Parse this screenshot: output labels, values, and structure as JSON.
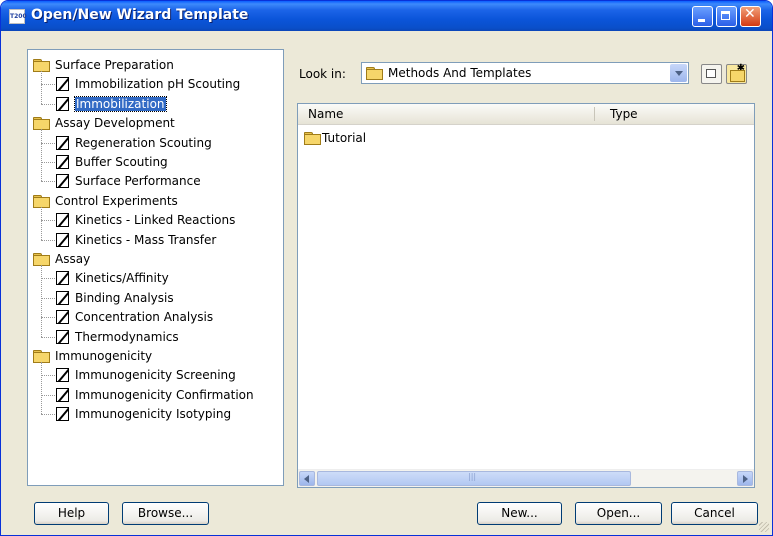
{
  "window": {
    "title": "Open/New Wizard Template",
    "app_icon_text": "T200"
  },
  "tree": {
    "groups": [
      {
        "label": "Surface Preparation",
        "items": [
          "Immobilization pH Scouting",
          "Immobilization"
        ]
      },
      {
        "label": "Assay Development",
        "items": [
          "Regeneration Scouting",
          "Buffer Scouting",
          "Surface Performance"
        ]
      },
      {
        "label": "Control Experiments",
        "items": [
          "Kinetics - Linked Reactions",
          "Kinetics - Mass Transfer"
        ]
      },
      {
        "label": "Assay",
        "items": [
          "Kinetics/Affinity",
          "Binding Analysis",
          "Concentration Analysis",
          "Thermodynamics"
        ]
      },
      {
        "label": "Immunogenicity",
        "items": [
          "Immunogenicity Screening",
          "Immunogenicity Confirmation",
          "Immunogenicity Isotyping"
        ]
      }
    ],
    "selected_item": "Immobilization"
  },
  "lookin": {
    "label": "Look in:",
    "value": "Methods And Templates"
  },
  "list": {
    "columns": [
      "Name",
      "Type"
    ],
    "rows": [
      {
        "name": "Tutorial",
        "type": ""
      }
    ]
  },
  "buttons": {
    "help": "Help",
    "browse": "Browse...",
    "new": "New...",
    "open": "Open...",
    "cancel": "Cancel"
  },
  "icons": {
    "folder": "folder-icon",
    "template": "template-icon",
    "up_folder": "up-one-level-icon",
    "new_folder": "create-new-folder-icon"
  }
}
